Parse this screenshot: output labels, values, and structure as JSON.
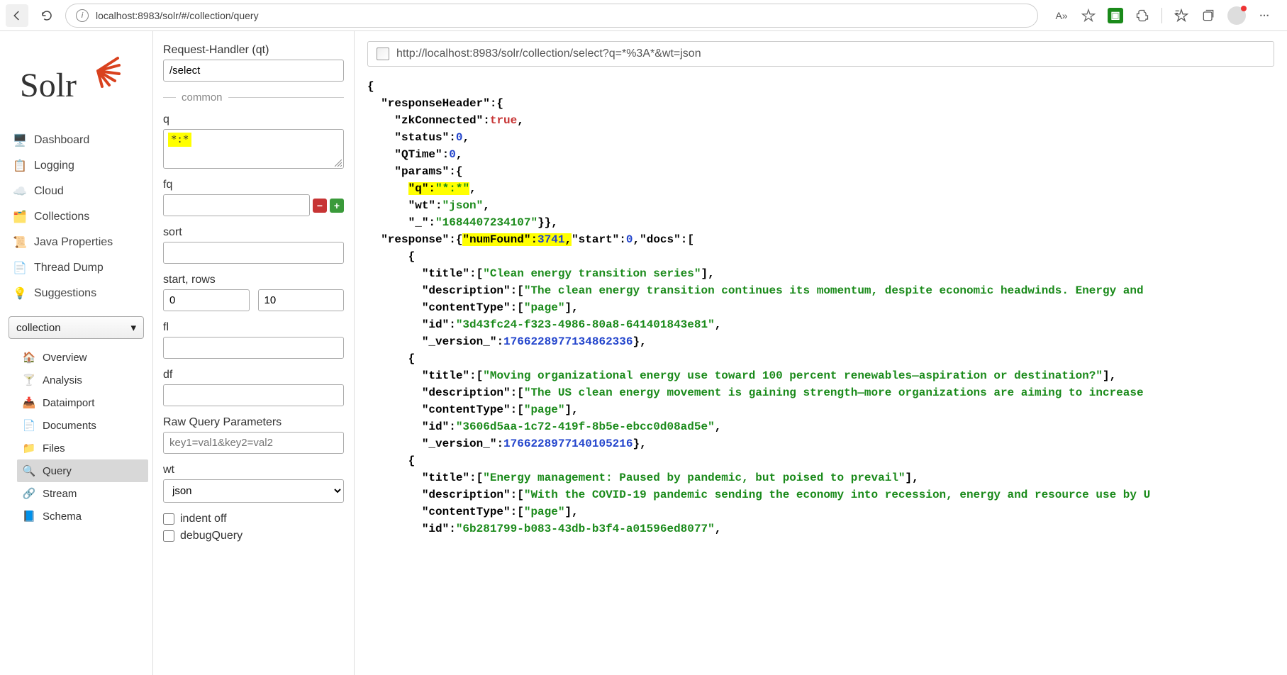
{
  "browser": {
    "url": "localhost:8983/solr/#/collection/query",
    "aa_icon": "A»"
  },
  "logo_text": "Solr",
  "nav": [
    "Dashboard",
    "Logging",
    "Cloud",
    "Collections",
    "Java Properties",
    "Thread Dump",
    "Suggestions"
  ],
  "collection_selected": "collection",
  "subnav": [
    "Overview",
    "Analysis",
    "Dataimport",
    "Documents",
    "Files",
    "Query",
    "Stream",
    "Schema"
  ],
  "subnav_active": "Query",
  "form": {
    "request_handler_label": "Request-Handler (qt)",
    "request_handler": "/select",
    "common_label": "common",
    "q_label": "q",
    "q": "*:*",
    "fq_label": "fq",
    "fq": "",
    "sort_label": "sort",
    "sort": "",
    "start_rows_label": "start, rows",
    "start": "0",
    "rows": "10",
    "fl_label": "fl",
    "fl": "",
    "df_label": "df",
    "df": "",
    "raw_params_label": "Raw Query Parameters",
    "raw_params_placeholder": "key1=val1&key2=val2",
    "wt_label": "wt",
    "wt": "json",
    "indent_label": "indent off",
    "debug_label": "debugQuery"
  },
  "result_url": "http://localhost:8983/solr/collection/select?q=*%3A*&wt=json",
  "response": {
    "header": {
      "zkConnected": "true",
      "status": "0",
      "QTime": "0",
      "params_q": "\"*:*\"",
      "params_wt": "json",
      "params_underscore": "1684407234107"
    },
    "numFound": "3741",
    "start": "0",
    "docs": [
      {
        "title": "Clean energy transition series",
        "description": "The clean energy transition continues its momentum, despite economic headwinds. Energy and ",
        "contentType": "page",
        "id": "3d43fc24-f323-4986-80a8-641401843e81",
        "version": "1766228977134862336"
      },
      {
        "title": "Moving organizational energy use toward 100 percent renewables—aspiration or destination?",
        "description": "The US clean energy movement is gaining strength—more organizations are aiming to increase ",
        "contentType": "page",
        "id": "3606d5aa-1c72-419f-8b5e-ebcc0d08ad5e",
        "version": "1766228977140105216"
      },
      {
        "title": "Energy management: Paused by pandemic, but poised to prevail",
        "description": "With the COVID-19 pandemic sending the economy into recession, energy and resource use by U",
        "contentType": "page",
        "id": "6b281799-b083-43db-b3f4-a01596ed8077"
      }
    ]
  }
}
